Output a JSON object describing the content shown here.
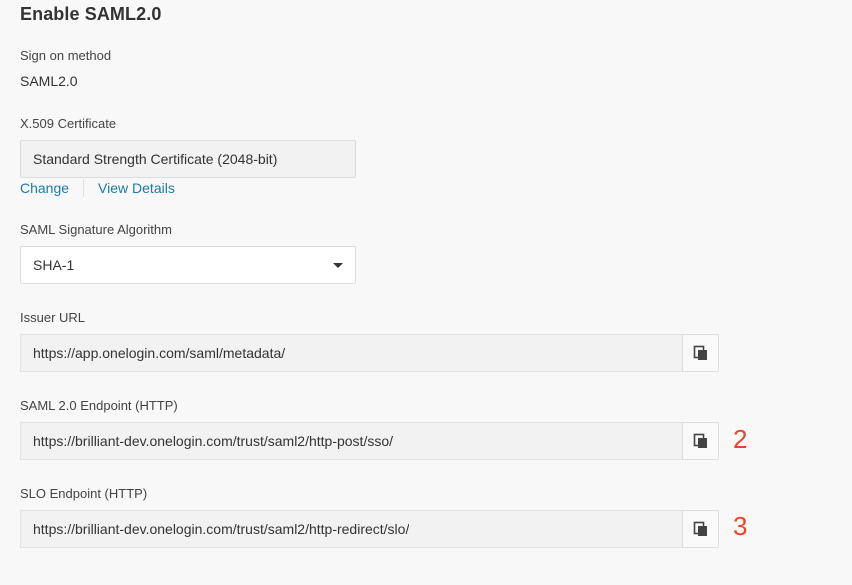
{
  "section": {
    "title": "Enable SAML2.0"
  },
  "sign_on": {
    "label": "Sign on method",
    "value": "SAML2.0"
  },
  "certificate": {
    "label": "X.509 Certificate",
    "value": "Standard Strength Certificate (2048-bit)",
    "change_label": "Change",
    "view_details_label": "View Details"
  },
  "signature": {
    "label": "SAML Signature Algorithm",
    "value": "SHA-1"
  },
  "issuer": {
    "label": "Issuer URL",
    "value": "https://app.onelogin.com/saml/metadata/"
  },
  "endpoint": {
    "label": "SAML 2.0 Endpoint (HTTP)",
    "value": "https://brilliant-dev.onelogin.com/trust/saml2/http-post/sso/",
    "annotation": "2"
  },
  "slo": {
    "label": "SLO Endpoint (HTTP)",
    "value": "https://brilliant-dev.onelogin.com/trust/saml2/http-redirect/slo/",
    "annotation": "3"
  },
  "icons": {
    "copy": "copy-icon",
    "dropdown": "caret-down-icon"
  },
  "colors": {
    "link": "#1a7ca6",
    "annotation": "#e8452c",
    "readonly_bg": "#f2f2f2"
  }
}
